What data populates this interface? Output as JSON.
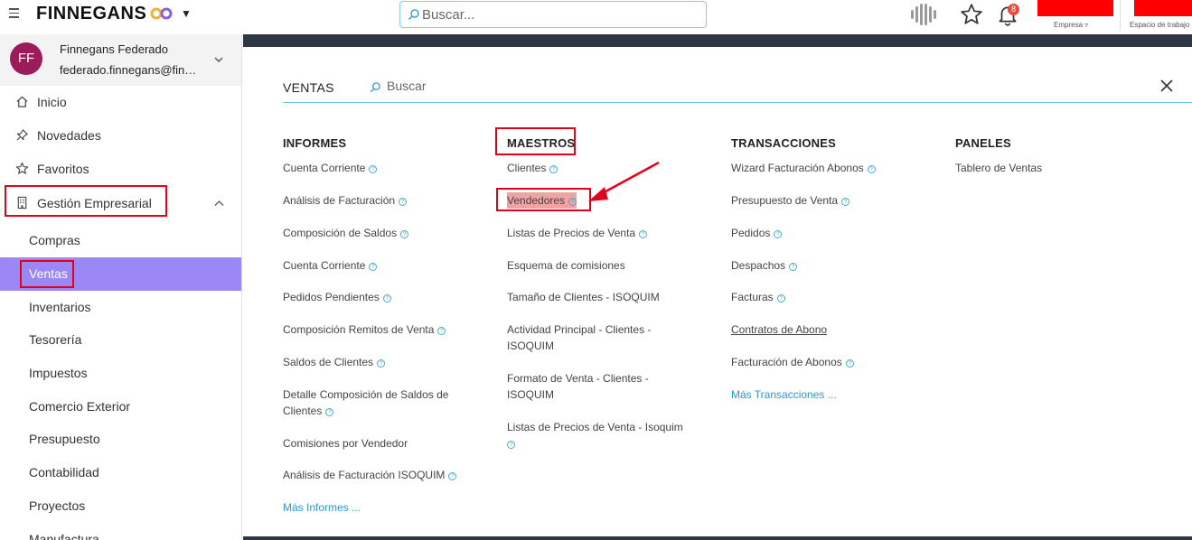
{
  "topbar": {
    "brand": "FINNEGANS",
    "search_placeholder": "Buscar...",
    "notification_count": "8",
    "empresa_label": "Empresa ▿",
    "espacio_label": "Espacio de trabajo"
  },
  "user": {
    "initials": "FF",
    "name": "Finnegans Federado",
    "email": "federado.finnegans@finnegans.com.ar"
  },
  "sidebar": {
    "items": [
      {
        "label": "Inicio"
      },
      {
        "label": "Novedades"
      },
      {
        "label": "Favoritos"
      },
      {
        "label": "Gestión Empresarial"
      }
    ],
    "subitems": [
      {
        "label": "Compras"
      },
      {
        "label": "Ventas"
      },
      {
        "label": "Inventarios"
      },
      {
        "label": "Tesorería"
      },
      {
        "label": "Impuestos"
      },
      {
        "label": "Comercio Exterior"
      },
      {
        "label": "Presupuesto"
      },
      {
        "label": "Contabilidad"
      },
      {
        "label": "Proyectos"
      },
      {
        "label": "Manufactura"
      }
    ]
  },
  "panel": {
    "title": "VENTAS",
    "search_placeholder": "Buscar",
    "columns": [
      {
        "heading": "INFORMES",
        "links": [
          "Cuenta Corriente",
          "Análisis de Facturación",
          "Composición de Saldos",
          "Cuenta Corriente",
          "Pedidos Pendientes",
          "Composición Remitos de Venta",
          "Saldos de Clientes",
          "Detalle Composición de Saldos de Clientes",
          "Comisiones por Vendedor",
          "Análisis de Facturación ISOQUIM",
          "Más Informes ..."
        ]
      },
      {
        "heading": "MAESTROS",
        "links": [
          "Clientes",
          "Vendedores",
          "Listas de Precios de Venta",
          "Esquema de comisiones",
          "Tamaño de Clientes - ISOQUIM",
          "Actividad Principal - Clientes - ISOQUIM",
          "Formato de Venta - Clientes - ISOQUIM",
          "Listas de Precios de Venta - Isoquim"
        ]
      },
      {
        "heading": "TRANSACCIONES",
        "links": [
          "Wizard Facturación Abonos",
          "Presupuesto de Venta",
          "Pedidos",
          "Despachos",
          "Facturas",
          "Contratos de Abono",
          "Facturación de Abonos",
          "Más Transacciones ..."
        ]
      },
      {
        "heading": "PANELES",
        "links": [
          "Tablero de Ventas"
        ]
      }
    ]
  },
  "colors": {
    "active_bg": "#9b87f5",
    "highlight": "#e3001b",
    "link_accent": "#2a9bc7",
    "avatar_bg": "#9c1b5a",
    "dark_bg": "#2f3644"
  }
}
